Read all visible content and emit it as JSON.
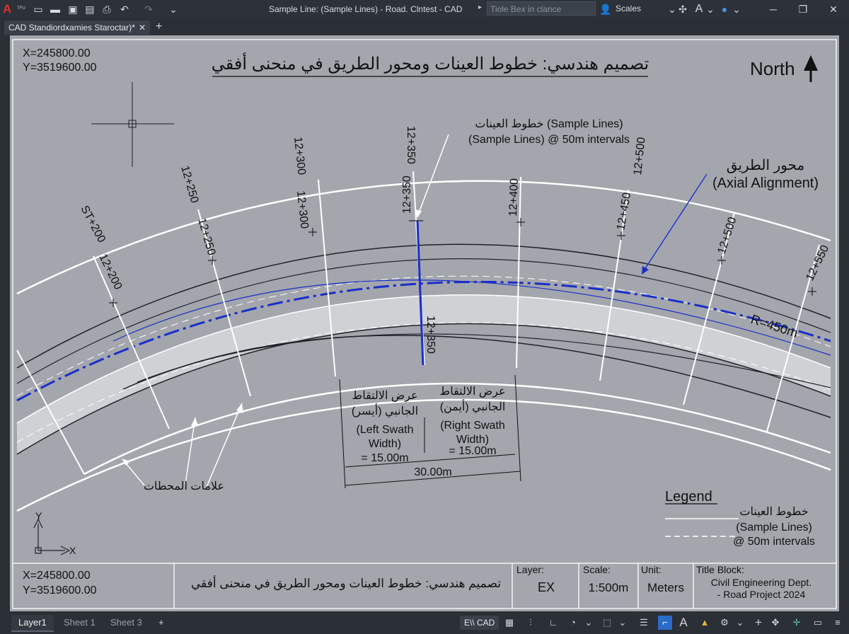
{
  "app": {
    "logo": "A",
    "logo_sub": "TFU",
    "title": "Sample Line: (Sample Lines) - Road. Clntest - CAD",
    "search_placeholder": "Tiole Bex in clance",
    "scales_label": "Scales"
  },
  "icons": {
    "quick_access": [
      "new-file-icon",
      "open-folder-icon",
      "save-icon",
      "save-as-icon",
      "print-icon",
      "undo-icon",
      "redo-icon",
      "more-icon"
    ],
    "window": [
      "minimize-icon",
      "restore-icon",
      "close-icon"
    ]
  },
  "tabs": {
    "document": "CAD Standiordxamies Staroctar)*",
    "close": "✕",
    "new": "+"
  },
  "drawing": {
    "coord_x": "X=245800.00",
    "coord_y": "Y=3519600.00",
    "title_ar": "تصميم هندسي: خطوط العينات ومحور الطريق في منحنى أفقي",
    "north": "North",
    "sample_lines_callout_ar": "خطوط العينات (Sample Lines)",
    "sample_lines_callout_en": "(Sample Lines) @ 50m intervals",
    "alignment_ar": "محور الطريق",
    "alignment_en": "(Axial Alignment)",
    "radius": "R=450m",
    "stations_outer": [
      "ST+200",
      "12+250",
      "12+300",
      "12+350",
      "12+500"
    ],
    "stations_inner": [
      "12+200",
      "12+250",
      "12+300",
      "12+350",
      "12+400",
      "12+450",
      "12+500",
      "12+550"
    ],
    "station_below": "12+350",
    "left_swath": [
      "عرض الالتقاط",
      "الجانبي (أيسر)",
      "(Left Swath",
      "Width)",
      "= 15.00m"
    ],
    "right_swath": [
      "عرض الالتقاط",
      "الجانبي (أيمن)",
      "(Right Swath",
      "Width)",
      "= 15.00m"
    ],
    "total_width": "30.00m",
    "station_marks_ar": "علامات المحطات",
    "ucs_x": "X",
    "ucs_y": "Y",
    "legend": {
      "title": "Legend",
      "line1": "خطوط العينات",
      "line2": "(Sample Lines)",
      "line3": "@ 50m intervals"
    },
    "title_block": {
      "x": "X=245800.00",
      "y": "Y=3519600.00",
      "title_ar": "تصميم هندسي: خطوط العينات ومحور الطريق في منحنى أفقي",
      "layer_label": "Layer:",
      "layer_value": "EX",
      "scale_label": "Scale:",
      "scale_value": "1:500m",
      "unit_label": "Unit:",
      "unit_value": "Meters",
      "tb_label": "Title Block:",
      "tb_line1": "Civil Engineering Dept.",
      "tb_line2": "- Road Project 2024"
    }
  },
  "layouts": {
    "tabs": [
      "Layer1",
      "Sheet 1",
      "Sheet 3"
    ],
    "add": "+"
  },
  "status": {
    "cad_label": "E\\\\ CAD"
  },
  "colors": {
    "alignment": "#1a2ec8",
    "canvas": "#a3a6ac",
    "road_fill": "#cfd1d5"
  }
}
